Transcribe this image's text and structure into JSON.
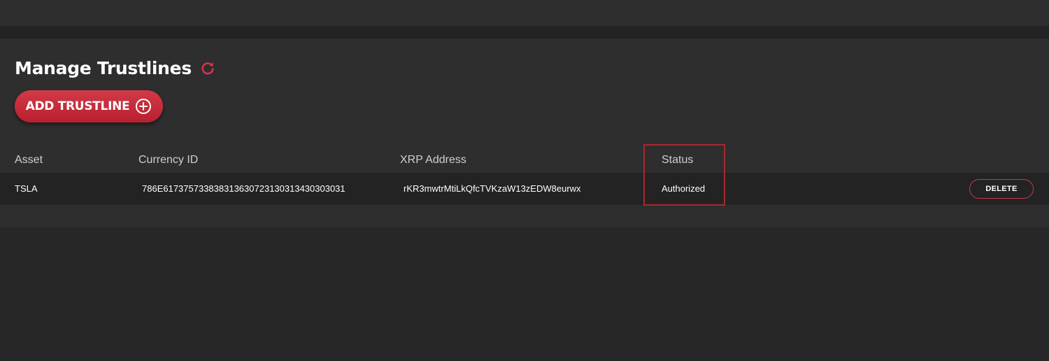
{
  "header": {
    "title": "Manage Trustlines",
    "refresh_icon": "refresh-icon",
    "accent_color": "#d63645"
  },
  "actions": {
    "add_trustline_label": "ADD TRUSTLINE",
    "add_icon": "plus-circle-icon"
  },
  "table": {
    "columns": [
      "Asset",
      "Currency ID",
      "XRP Address",
      "Status"
    ],
    "rows": [
      {
        "asset": "TSLA",
        "currency_id": "786E6173757338383136307231303134303030​31",
        "xrp_address": "rKR3mwtrMtiLkQfcTVKzaW13zEDW8eurwx",
        "status": "Authorized",
        "delete_label": "DELETE"
      }
    ]
  },
  "annotation": {
    "highlight_color": "#a8292e"
  }
}
